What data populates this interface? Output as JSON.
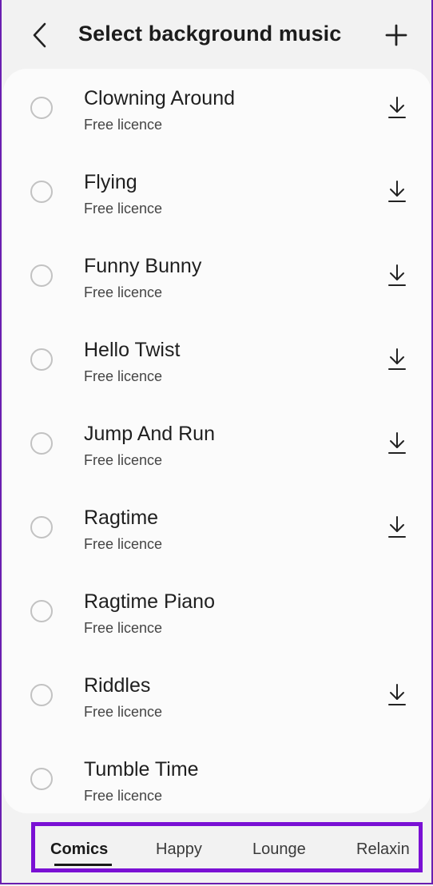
{
  "header": {
    "title": "Select background music",
    "back_icon": "chevron-left-icon",
    "add_icon": "plus-icon"
  },
  "tracks": [
    {
      "title": "Clowning Around",
      "license": "Free licence",
      "downloadable": true
    },
    {
      "title": "Flying",
      "license": "Free licence",
      "downloadable": true
    },
    {
      "title": "Funny Bunny",
      "license": "Free licence",
      "downloadable": true
    },
    {
      "title": "Hello Twist",
      "license": "Free licence",
      "downloadable": true
    },
    {
      "title": "Jump And Run",
      "license": "Free licence",
      "downloadable": true
    },
    {
      "title": "Ragtime",
      "license": "Free licence",
      "downloadable": true
    },
    {
      "title": "Ragtime Piano",
      "license": "Free licence",
      "downloadable": false
    },
    {
      "title": "Riddles",
      "license": "Free licence",
      "downloadable": true
    },
    {
      "title": "Tumble Time",
      "license": "Free licence",
      "downloadable": false
    }
  ],
  "tabs": [
    {
      "label": "Comics",
      "active": true
    },
    {
      "label": "Happy",
      "active": false
    },
    {
      "label": "Lounge",
      "active": false
    },
    {
      "label": "Relaxin",
      "active": false
    }
  ],
  "colors": {
    "highlight_border": "#7a10d4",
    "frame_border": "#6a1fb0",
    "card_background": "#fbfbfb",
    "page_background": "#f2f2f2"
  }
}
